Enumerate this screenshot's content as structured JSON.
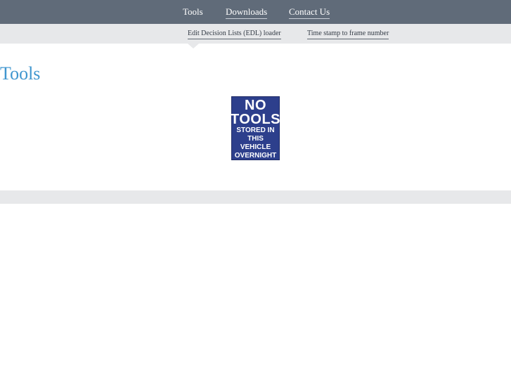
{
  "nav": {
    "items": [
      {
        "label": "Tools"
      },
      {
        "label": "Downloads"
      },
      {
        "label": "Contact Us"
      }
    ]
  },
  "subnav": {
    "items": [
      {
        "label": "Edit Decision Lists (EDL) loader"
      },
      {
        "label": "Time stamp to frame number"
      }
    ]
  },
  "main": {
    "title": "Tools",
    "sign_lines": [
      "NO",
      "TOOLS",
      "STORED IN",
      "THIS",
      "VEHICLE",
      "OVERNIGHT"
    ]
  },
  "colors": {
    "nav_bg": "#606b79",
    "subnav_bg": "#e7e8ea",
    "title": "#3f96cf",
    "sign_bg": "#2d3f8c"
  }
}
